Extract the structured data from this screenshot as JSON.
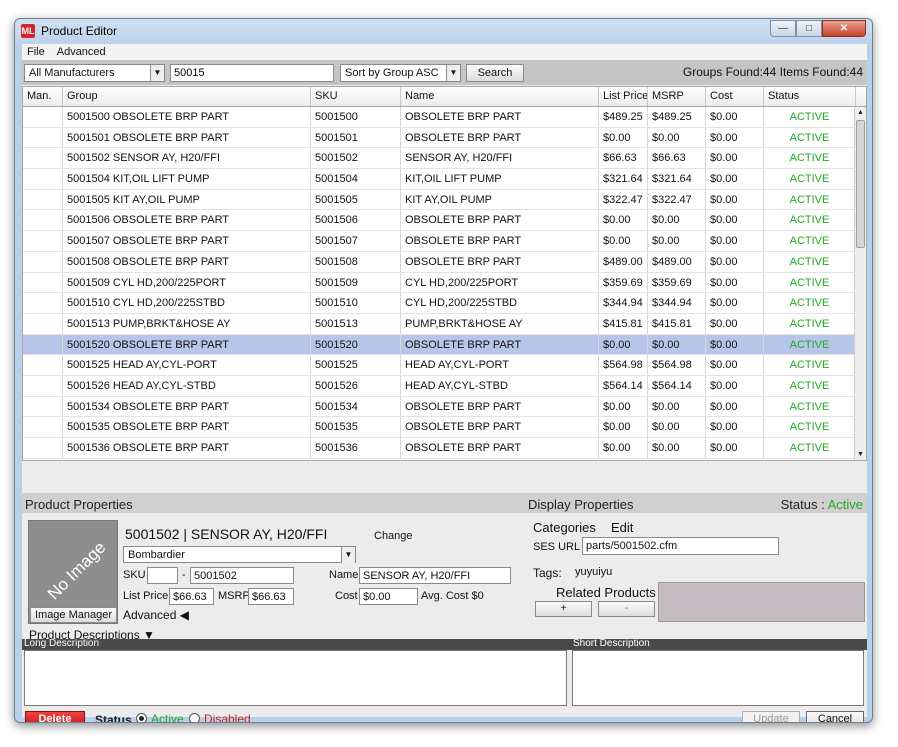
{
  "window": {
    "title": "Product Editor",
    "app_icon": "ML",
    "btn_min": "—",
    "btn_max": "□",
    "btn_close": "✕"
  },
  "menu": [
    "File",
    "Advanced"
  ],
  "search": {
    "manufacturer": "All Manufacturers",
    "query": "50015",
    "sort": "Sort by Group ASC",
    "button": "Search",
    "found": "Groups Found:44 Items Found:44"
  },
  "grid": {
    "columns": [
      "Man.",
      "Group",
      "SKU",
      "Name",
      "List Price",
      "MSRP",
      "Cost",
      "Status"
    ],
    "rows": [
      {
        "man": "",
        "group": "5001500 OBSOLETE BRP PART",
        "sku": "5001500",
        "name": "OBSOLETE BRP PART",
        "list_price": "$489.25",
        "msrp": "$489.25",
        "cost": "$0.00",
        "status": "ACTIVE"
      },
      {
        "man": "",
        "group": "5001501 OBSOLETE BRP PART",
        "sku": "5001501",
        "name": "OBSOLETE BRP PART",
        "list_price": "$0.00",
        "msrp": "$0.00",
        "cost": "$0.00",
        "status": "ACTIVE"
      },
      {
        "man": "",
        "group": "5001502 SENSOR AY, H20/FFI",
        "sku": "5001502",
        "name": "SENSOR AY, H20/FFI",
        "list_price": "$66.63",
        "msrp": "$66.63",
        "cost": "$0.00",
        "status": "ACTIVE"
      },
      {
        "man": "",
        "group": "5001504 KIT,OIL LIFT PUMP",
        "sku": "5001504",
        "name": "KIT,OIL LIFT PUMP",
        "list_price": "$321.64",
        "msrp": "$321.64",
        "cost": "$0.00",
        "status": "ACTIVE"
      },
      {
        "man": "",
        "group": "5001505 KIT AY,OIL PUMP",
        "sku": "5001505",
        "name": "KIT AY,OIL PUMP",
        "list_price": "$322.47",
        "msrp": "$322.47",
        "cost": "$0.00",
        "status": "ACTIVE"
      },
      {
        "man": "",
        "group": "5001506 OBSOLETE BRP PART",
        "sku": "5001506",
        "name": "OBSOLETE BRP PART",
        "list_price": "$0.00",
        "msrp": "$0.00",
        "cost": "$0.00",
        "status": "ACTIVE"
      },
      {
        "man": "",
        "group": "5001507 OBSOLETE BRP PART",
        "sku": "5001507",
        "name": "OBSOLETE BRP PART",
        "list_price": "$0.00",
        "msrp": "$0.00",
        "cost": "$0.00",
        "status": "ACTIVE"
      },
      {
        "man": "",
        "group": "5001508 OBSOLETE BRP PART",
        "sku": "5001508",
        "name": "OBSOLETE BRP PART",
        "list_price": "$489.00",
        "msrp": "$489.00",
        "cost": "$0.00",
        "status": "ACTIVE"
      },
      {
        "man": "",
        "group": "5001509 CYL HD,200/225PORT",
        "sku": "5001509",
        "name": "CYL HD,200/225PORT",
        "list_price": "$359.69",
        "msrp": "$359.69",
        "cost": "$0.00",
        "status": "ACTIVE"
      },
      {
        "man": "",
        "group": "5001510 CYL HD,200/225STBD",
        "sku": "5001510",
        "name": "CYL HD,200/225STBD",
        "list_price": "$344.94",
        "msrp": "$344.94",
        "cost": "$0.00",
        "status": "ACTIVE"
      },
      {
        "man": "",
        "group": "5001513 PUMP,BRKT&HOSE AY",
        "sku": "5001513",
        "name": "PUMP,BRKT&HOSE AY",
        "list_price": "$415.81",
        "msrp": "$415.81",
        "cost": "$0.00",
        "status": "ACTIVE"
      },
      {
        "man": "",
        "group": "5001520 OBSOLETE BRP PART",
        "sku": "5001520",
        "name": "OBSOLETE BRP PART",
        "list_price": "$0.00",
        "msrp": "$0.00",
        "cost": "$0.00",
        "status": "ACTIVE",
        "selected": true
      },
      {
        "man": "",
        "group": "5001525 HEAD AY,CYL-PORT",
        "sku": "5001525",
        "name": "HEAD AY,CYL-PORT",
        "list_price": "$564.98",
        "msrp": "$564.98",
        "cost": "$0.00",
        "status": "ACTIVE"
      },
      {
        "man": "",
        "group": "5001526 HEAD AY,CYL-STBD",
        "sku": "5001526",
        "name": "HEAD AY,CYL-STBD",
        "list_price": "$564.14",
        "msrp": "$564.14",
        "cost": "$0.00",
        "status": "ACTIVE"
      },
      {
        "man": "",
        "group": "5001534 OBSOLETE BRP PART",
        "sku": "5001534",
        "name": "OBSOLETE BRP PART",
        "list_price": "$0.00",
        "msrp": "$0.00",
        "cost": "$0.00",
        "status": "ACTIVE"
      },
      {
        "man": "",
        "group": "5001535 OBSOLETE BRP PART",
        "sku": "5001535",
        "name": "OBSOLETE BRP PART",
        "list_price": "$0.00",
        "msrp": "$0.00",
        "cost": "$0.00",
        "status": "ACTIVE"
      },
      {
        "man": "",
        "group": "5001536 OBSOLETE BRP PART",
        "sku": "5001536",
        "name": "OBSOLETE BRP PART",
        "list_price": "$0.00",
        "msrp": "$0.00",
        "cost": "$0.00",
        "status": "ACTIVE"
      }
    ],
    "status_color": "#22aa22",
    "selected_color": "#b7c6e8"
  },
  "product": {
    "section_title": "Product Properties",
    "no_image": "No Image",
    "image_manager": "Image Manager",
    "heading": "5001502  |  SENSOR AY, H20/FFI",
    "change": "Change",
    "manufacturer": "Bombardier",
    "sku_label": "SKU",
    "sku_prefix": "",
    "sku_dash": "-",
    "sku_value": "5001502",
    "name_label": "Name",
    "name_value": "SENSOR AY, H20/FFI",
    "list_price_label": "List Price",
    "list_price": "$66.63",
    "msrp_label": "MSRP",
    "msrp": "$66.63",
    "cost_label": "Cost",
    "cost": "$0.00",
    "avg_cost": "Avg. Cost $0",
    "advanced": "Advanced ◀",
    "descriptions_toggle": "Product Descriptions ▼"
  },
  "display": {
    "section_title": "Display Properties",
    "status_label": "Status : ",
    "status_value": "Active",
    "categories": "Categories",
    "edit": "Edit",
    "ses_url_label": "SES URL",
    "ses_url": "parts/5001502.cfm",
    "tags_label": "Tags:",
    "tags_value": "yuyuiyu",
    "related": "Related Products",
    "add": "+",
    "remove": "-"
  },
  "descriptions": {
    "long_label": "Long Description",
    "short_label": "Short Description",
    "long_value": "",
    "short_value": ""
  },
  "footer": {
    "delete": "Delete",
    "status_label": "Status",
    "active": "Active",
    "disabled": "Disabled",
    "update": "Update",
    "cancel": "Cancel",
    "active_color": "#22aa22",
    "disabled_color": "#cc2222"
  }
}
